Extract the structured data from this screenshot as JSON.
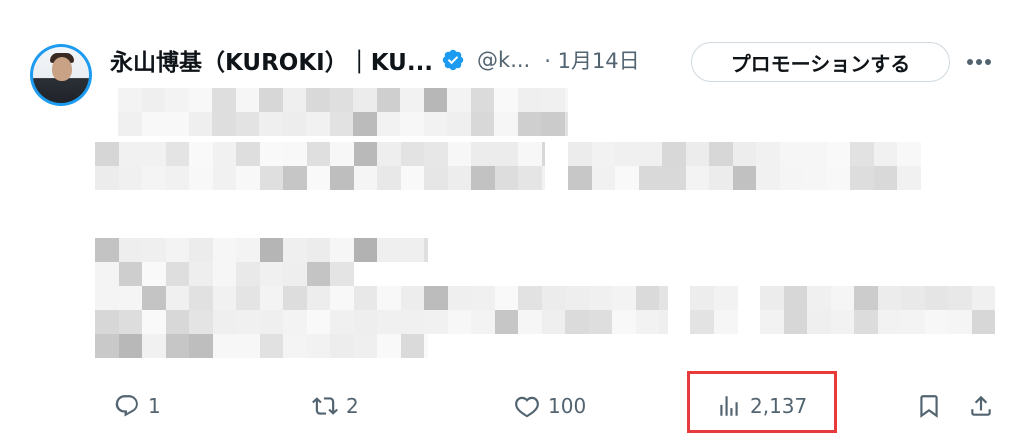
{
  "author": {
    "name": "永山博基（KUROKI）｜KU...",
    "handle": "@k...",
    "date": "· 1月14日"
  },
  "header": {
    "promote_label": "プロモーションする",
    "more_icon": "more-horizontal-icon",
    "verified_icon": "verified-badge-icon",
    "verified_color": "#1d9bf0"
  },
  "actions": {
    "reply_count": "1",
    "retweet_count": "2",
    "like_count": "100",
    "views_count": "2,137"
  },
  "colors": {
    "highlight_border": "#e83a3a",
    "secondary_text": "#536471"
  }
}
